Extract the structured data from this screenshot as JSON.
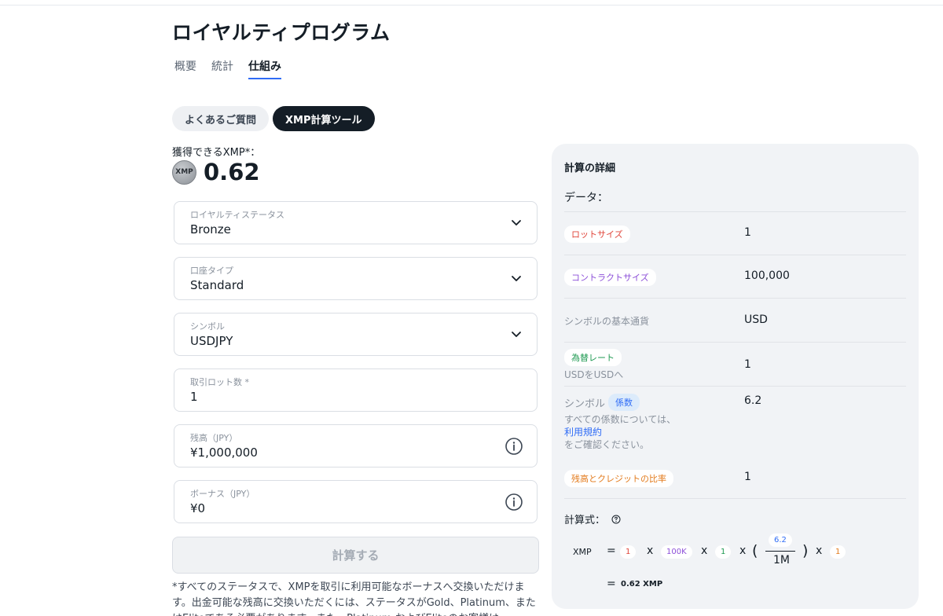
{
  "page": {
    "title": "ロイヤルティプログラム"
  },
  "tabs": [
    {
      "label": "概要"
    },
    {
      "label": "統計"
    },
    {
      "label": "仕組み"
    }
  ],
  "pills": [
    {
      "label": "よくあるご質問"
    },
    {
      "label": "XMP計算ツール"
    }
  ],
  "earn": {
    "label": "獲得できるXMP*：",
    "coin": "XMP",
    "value": "0.62"
  },
  "fields": {
    "status": {
      "label": "ロイヤルティステータス",
      "value": "Bronze",
      "icon": "chevron-down-icon"
    },
    "account_type": {
      "label": "口座タイプ",
      "value": "Standard",
      "icon": "chevron-down-icon"
    },
    "symbol": {
      "label": "シンボル",
      "value": "USDJPY",
      "icon": "chevron-down-icon"
    },
    "lots": {
      "label": "取引ロット数 *",
      "value": "1"
    },
    "balance": {
      "label": "残高（JPY）",
      "value": "¥1,000,000",
      "icon": "info-icon"
    },
    "bonus": {
      "label": "ボーナス（JPY）",
      "value": "¥0",
      "icon": "info-icon"
    }
  },
  "calculate_button": "計算する",
  "footnote": "*すべてのステータスで、XMPを取引に利用可能なボーナスへ交換いただけます。出金可能な残高に交換いただくには、ステータスがGold、Platinum、またはEliteである必要があります。また、Platinum およびEliteのお客様は",
  "details": {
    "title": "計算の詳細",
    "data_label": "データ：",
    "rows": {
      "lot_size": {
        "label": "ロットサイズ",
        "value": "1"
      },
      "contract_size": {
        "label": "コントラクトサイズ",
        "value": "100,000"
      },
      "base_currency": {
        "label": "シンボルの基本通貨",
        "value": "USD"
      },
      "fx_rate": {
        "label": "為替レート",
        "sublabel": "USDをUSDへ",
        "value": "1"
      },
      "symbol_coef": {
        "label": "シンボル",
        "badge": "係数",
        "note": "すべての係数については、",
        "link": "利用規約",
        "note2": "をご確認ください。",
        "value": "6.2"
      },
      "balance_ratio": {
        "label": "残高とクレジットの比率",
        "value": "1"
      }
    },
    "formula": {
      "label": "計算式：",
      "lhs": "XMP",
      "eq": "=",
      "x": "x",
      "lot": "1",
      "contract": "100K",
      "fx": "1",
      "open_paren": "(",
      "close_paren": ")",
      "coef": "6.2",
      "denominator": "1M",
      "ratio": "1",
      "result": "0.62 XMP"
    }
  },
  "colors": {
    "accent": "#2f6cf6",
    "dark": "#141d26",
    "panel": "#f1f3f6",
    "red": "#e0453a",
    "purple": "#8c4fd8",
    "green": "#1f9a52",
    "orange": "#e37b1d"
  }
}
